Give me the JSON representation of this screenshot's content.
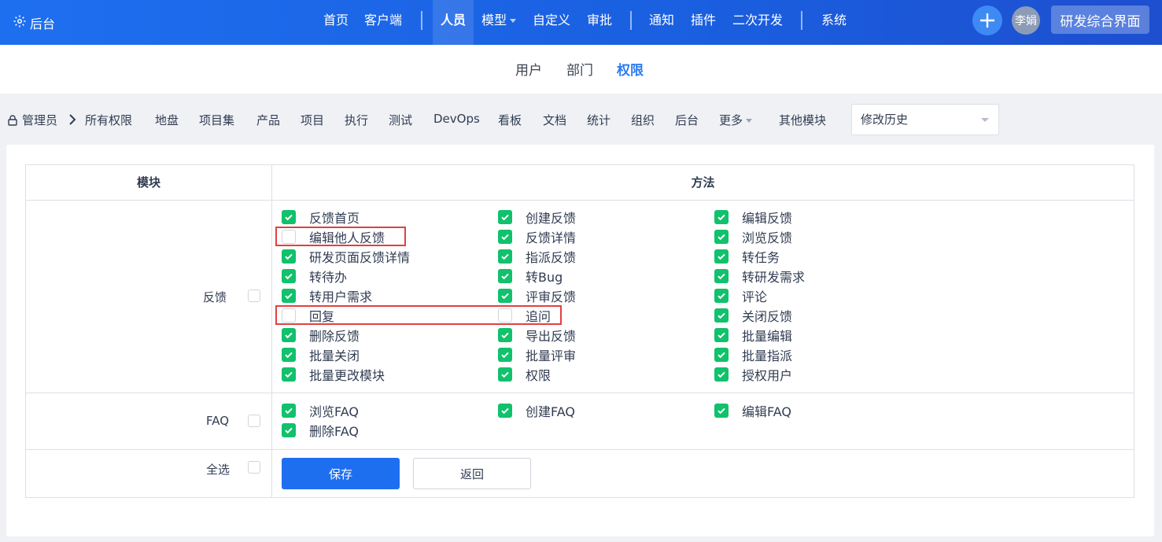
{
  "topnav": {
    "brand": "后台",
    "items": [
      "首页",
      "客户端",
      "人员",
      "模型",
      "自定义",
      "审批",
      "通知",
      "插件",
      "二次开发",
      "系统"
    ],
    "avatar": "李娟",
    "dev_button": "研发综合界面"
  },
  "subnav": [
    "用户",
    "部门",
    "权限"
  ],
  "modbar": {
    "group": "管理员",
    "items": [
      "所有权限",
      "地盘",
      "项目集",
      "产品",
      "项目",
      "执行",
      "测试",
      "DevOps",
      "看板",
      "文档",
      "统计",
      "组织",
      "后台",
      "更多",
      "其他模块"
    ],
    "history_select": "修改历史"
  },
  "table": {
    "col_module": "模块",
    "col_method": "方法"
  },
  "modules": {
    "feedback": {
      "label": "反馈",
      "perms": [
        {
          "label": "反馈首页",
          "checked": true
        },
        {
          "label": "创建反馈",
          "checked": true
        },
        {
          "label": "编辑反馈",
          "checked": true
        },
        {
          "label": "编辑他人反馈",
          "checked": false
        },
        {
          "label": "反馈详情",
          "checked": true
        },
        {
          "label": "浏览反馈",
          "checked": true
        },
        {
          "label": "研发页面反馈详情",
          "checked": true
        },
        {
          "label": "指派反馈",
          "checked": true
        },
        {
          "label": "转任务",
          "checked": true
        },
        {
          "label": "转待办",
          "checked": true
        },
        {
          "label": "转Bug",
          "checked": true
        },
        {
          "label": "转研发需求",
          "checked": true
        },
        {
          "label": "转用户需求",
          "checked": true
        },
        {
          "label": "评审反馈",
          "checked": true
        },
        {
          "label": "评论",
          "checked": true
        },
        {
          "label": "回复",
          "checked": false
        },
        {
          "label": "追问",
          "checked": false
        },
        {
          "label": "关闭反馈",
          "checked": true
        },
        {
          "label": "删除反馈",
          "checked": true
        },
        {
          "label": "导出反馈",
          "checked": true
        },
        {
          "label": "批量编辑",
          "checked": true
        },
        {
          "label": "批量关闭",
          "checked": true
        },
        {
          "label": "批量评审",
          "checked": true
        },
        {
          "label": "批量指派",
          "checked": true
        },
        {
          "label": "批量更改模块",
          "checked": true
        },
        {
          "label": "权限",
          "checked": true
        },
        {
          "label": "授权用户",
          "checked": true
        }
      ]
    },
    "faq": {
      "label": "FAQ",
      "perms": [
        {
          "label": "浏览FAQ",
          "checked": true
        },
        {
          "label": "创建FAQ",
          "checked": true
        },
        {
          "label": "编辑FAQ",
          "checked": true
        },
        {
          "label": "删除FAQ",
          "checked": true
        }
      ]
    },
    "select_all": "全选"
  },
  "actions": {
    "save": "保存",
    "back": "返回"
  },
  "colors": {
    "primary": "#1e6ff0",
    "checked": "#11c16c",
    "highlight": "#e24040"
  }
}
